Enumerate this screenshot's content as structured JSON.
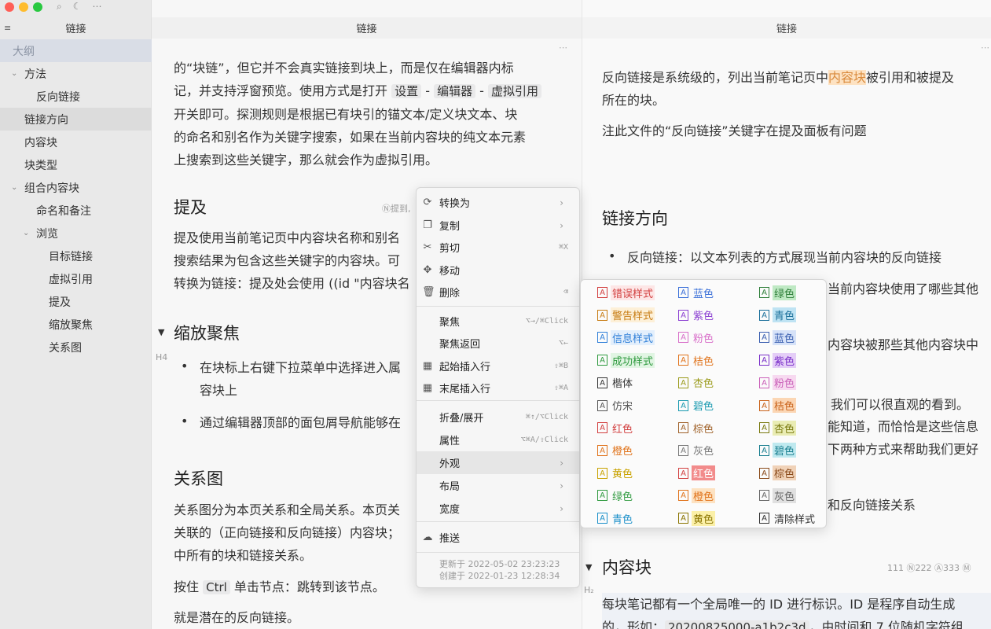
{
  "window": {
    "title": "链接",
    "search_icon": "search-icon",
    "theme_icon": "moon-icon",
    "more_icon": "more-icon"
  },
  "sidebar": {
    "title": "链接",
    "items": [
      {
        "label": "大纲",
        "level": 0,
        "state": "active"
      },
      {
        "label": "方法",
        "level": 1,
        "expanded": true
      },
      {
        "label": "反向链接",
        "level": 2
      },
      {
        "label": "链接方向",
        "level": 1,
        "state": "hover"
      },
      {
        "label": "内容块",
        "level": 1
      },
      {
        "label": "块类型",
        "level": 1
      },
      {
        "label": "组合内容块",
        "level": 1,
        "expanded": true
      },
      {
        "label": "命名和备注",
        "level": 2
      },
      {
        "label": "浏览",
        "level": 2,
        "expanded": true
      },
      {
        "label": "目标链接",
        "level": 3
      },
      {
        "label": "虚拟引用",
        "level": 3
      },
      {
        "label": "提及",
        "level": 3
      },
      {
        "label": "缩放聚焦",
        "level": 3
      },
      {
        "label": "关系图",
        "level": 3
      }
    ]
  },
  "pane1": {
    "tab": "链接",
    "p1_l1": "的“块链”，但它并不会真实链接到块上，而是仅在编辑器内标",
    "p1_l2a": "记，并支持浮窗预览。使用方式是打开 ",
    "p1_code1": "设置",
    "p1_sep1": " - ",
    "p1_code2": "编辑器",
    "p1_sep2": " - ",
    "p1_code3": "虚拟引用",
    "p1_l3": "开关即可。探测规则是根据已有块引的锚文本/定义块文本、块",
    "p1_l4": "的命名和别名作为关键字搜索，如果在当前内容块的纯文本元素",
    "p1_l5": "上搜索到这些关键字，那么就会作为虚拟引用。",
    "h_mention": "提及",
    "mention_ref": "Ⓝ提到,",
    "p2_l1": "提及使用当前笔记页中内容块名称和别名",
    "p2_l2": "搜索结果为包含这些关键字的内容块。可",
    "p2_l3a": "转换为链接：提及处会使用 ",
    "p2_l3b": "((id \"内容块名",
    "h_zoom": "缩放聚焦",
    "h4_marker": "H4",
    "b1_l1": "在块标上右键下拉菜单中选择进入属",
    "b1_l2": "容块上",
    "b2_l1": "通过编辑器顶部的面包屑导航能够在",
    "h_graph": "关系图",
    "p3_l1": "关系图分为本页关系和全局关系。本页关",
    "p3_l2": "关联的（正向链接和反向链接）内容块；",
    "p3_l3": "中所有的块和链接关系。",
    "p4a": "按住 ",
    "p4_code": "Ctrl",
    "p4b": " 单击节点：跳转到该节点。",
    "p5": "就是潜在的反向链接。"
  },
  "pane2": {
    "tab": "链接",
    "p1_l1a": "反向链接是系统级的，列出当前笔记页中",
    "p1_hl": "内容块",
    "p1_l1b": "被引用和被提及",
    "p1_l2": "所在的块。",
    "p2": "注此文件的“反向链接”关键字在提及面板有问题",
    "h_dir": "链接方向",
    "b1": "反向链接：以文本列表的方式展现当前内容块的反向链接",
    "b2_tail": "当前内容块使用了哪些其他",
    "b3_tail": "内容块被那些其他内容块中",
    "b4_tail": "，我们可以很直观的看到。",
    "b5_tail": "能知道，而恰恰是这些信息",
    "b6_tail": "下两种方式来帮助我们更好",
    "b7_tail": "和反向链接关系",
    "h_block": "内容块",
    "h2_marker": "H₂",
    "counts": "111  Ⓝ222  Ⓐ333  Ⓜ",
    "p3_l1": "每块笔记都有一个全局唯一的 ID 进行标识。ID 是程序自动生成",
    "p3_l2a": "的，形如：",
    "p3_code": "20200825000-a1b2c3d",
    "p3_l2b": "，由时间和 7 位随机字符组"
  },
  "context_menu": {
    "items": [
      {
        "icon": "convert-icon",
        "glyph": "⟳",
        "label": "转换为",
        "submenu": true
      },
      {
        "icon": "copy-icon",
        "glyph": "❐",
        "label": "复制",
        "submenu": true
      },
      {
        "icon": "scissors-icon",
        "glyph": "✂",
        "label": "剪切",
        "shortcut": "⌘X"
      },
      {
        "icon": "move-icon",
        "glyph": "✥",
        "label": "移动"
      },
      {
        "icon": "trash-icon",
        "glyph": "🗑",
        "label": "删除",
        "shortcut": "⌫"
      },
      {
        "icon": "",
        "glyph": "",
        "label": "聚焦",
        "shortcut": "⌥→/⌘Click"
      },
      {
        "icon": "",
        "glyph": "",
        "label": "聚焦返回",
        "shortcut": "⌥←"
      },
      {
        "icon": "table-icon",
        "glyph": "▦",
        "label": "起始插入行",
        "shortcut": "⇧⌘B"
      },
      {
        "icon": "table-icon",
        "glyph": "▦",
        "label": "末尾插入行",
        "shortcut": "⇧⌘A"
      },
      {
        "icon": "",
        "glyph": "",
        "label": "折叠/展开",
        "shortcut": "⌘↑/⌥Click"
      },
      {
        "icon": "",
        "glyph": "",
        "label": "属性",
        "shortcut": "⌥⌘A/⇧Click"
      },
      {
        "icon": "",
        "glyph": "",
        "label": "外观",
        "submenu": true,
        "state": "hover"
      },
      {
        "icon": "",
        "glyph": "",
        "label": "布局",
        "submenu": true
      },
      {
        "icon": "",
        "glyph": "",
        "label": "宽度",
        "submenu": true
      },
      {
        "icon": "share-icon",
        "glyph": "☁",
        "label": "推送"
      }
    ],
    "updated": "更新于 2022-05-02 23:23:23",
    "created": "创建于 2022-01-23 12:28:34"
  },
  "appearance": {
    "col1": [
      {
        "label": "错误样式",
        "color": "#d23f3f",
        "bg": "#fde6e6"
      },
      {
        "label": "警告样式",
        "color": "#c77b12",
        "bg": "#fdf0d8"
      },
      {
        "label": "信息样式",
        "color": "#2f7fd8",
        "bg": "#e3effc"
      },
      {
        "label": "成功样式",
        "color": "#2f9a3f",
        "bg": "#e1f5e3"
      },
      {
        "label": "楷体",
        "color": "#333333",
        "bg": ""
      },
      {
        "label": "仿宋",
        "color": "#555555",
        "bg": ""
      },
      {
        "label": "红色",
        "color": "#d23f3f",
        "bg": ""
      },
      {
        "label": "橙色",
        "color": "#e0731b",
        "bg": ""
      },
      {
        "label": "黄色",
        "color": "#c9a200",
        "bg": ""
      },
      {
        "label": "绿色",
        "color": "#2f9a3f",
        "bg": ""
      },
      {
        "label": "青色",
        "color": "#1a8fc9",
        "bg": ""
      }
    ],
    "col2": [
      {
        "label": "蓝色",
        "color": "#3a6fd8",
        "bg": ""
      },
      {
        "label": "紫色",
        "color": "#8b3fd2",
        "bg": ""
      },
      {
        "label": "粉色",
        "color": "#d86fc9",
        "bg": ""
      },
      {
        "label": "桔色",
        "color": "#e0731b",
        "bg": ""
      },
      {
        "label": "杏色",
        "color": "#9a9a1a",
        "bg": ""
      },
      {
        "label": "碧色",
        "color": "#1a9ab0",
        "bg": ""
      },
      {
        "label": "棕色",
        "color": "#a0622a",
        "bg": ""
      },
      {
        "label": "灰色",
        "color": "#777777",
        "bg": ""
      },
      {
        "label": "红色",
        "color": "#ffffff",
        "bg": "#f28b8b"
      },
      {
        "label": "橙色",
        "color": "#e0731b",
        "bg": "#fde2c2"
      },
      {
        "label": "黄色",
        "color": "#8a7400",
        "bg": "#fbf0a8"
      }
    ],
    "col3": [
      {
        "label": "绿色",
        "color": "#2f7f3a",
        "bg": "#bfe9c4"
      },
      {
        "label": "青色",
        "color": "#1a6f9a",
        "bg": "#bfe3f3"
      },
      {
        "label": "蓝色",
        "color": "#3a5fb0",
        "bg": "#d6e2f8"
      },
      {
        "label": "紫色",
        "color": "#7a2fc9",
        "bg": "#e4cdf7"
      },
      {
        "label": "粉色",
        "color": "#c95fb8",
        "bg": "#f7d9f0"
      },
      {
        "label": "桔色",
        "color": "#c9631b",
        "bg": "#fbd6b4"
      },
      {
        "label": "杏色",
        "color": "#7a7a10",
        "bg": "#e9ecb4"
      },
      {
        "label": "碧色",
        "color": "#1a7f90",
        "bg": "#bfe9ef"
      },
      {
        "label": "棕色",
        "color": "#8a4a1a",
        "bg": "#f0d2b8"
      },
      {
        "label": "灰色",
        "color": "#666666",
        "bg": "#e0e0e0"
      },
      {
        "label": "清除样式",
        "color": "#333333",
        "bg": ""
      }
    ]
  }
}
